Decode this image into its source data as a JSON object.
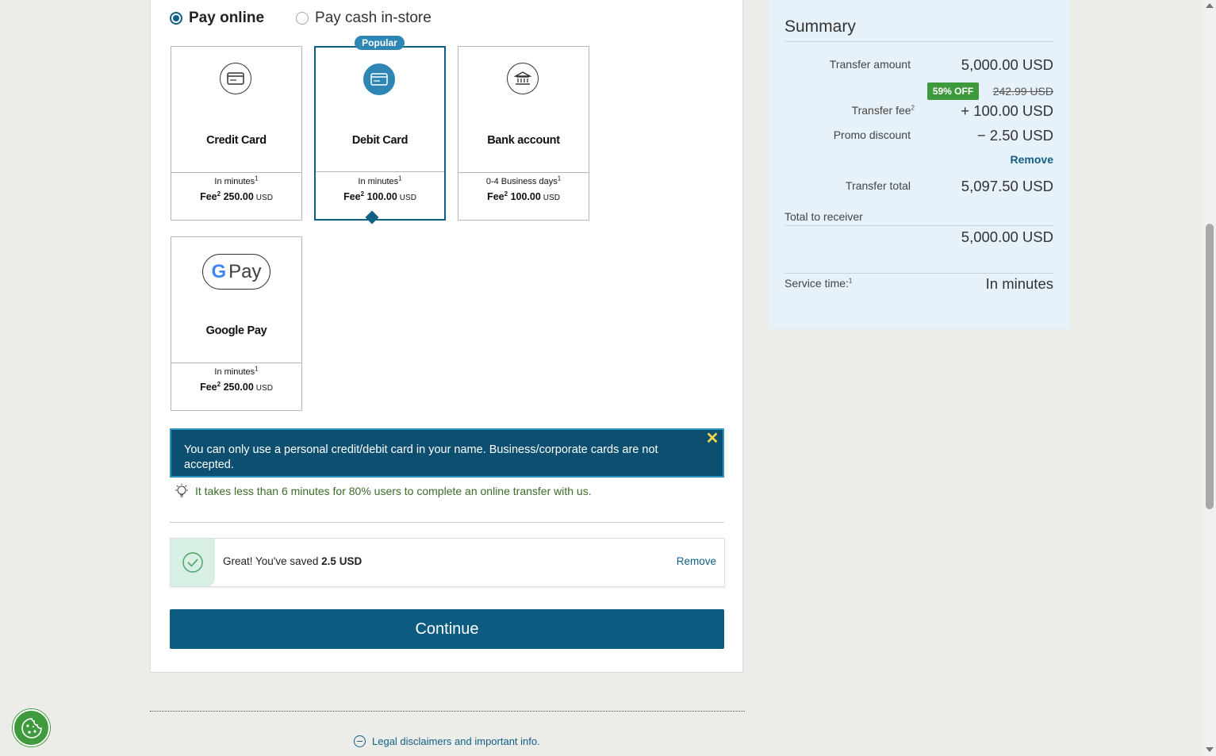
{
  "payment_mode": {
    "online_label": "Pay online",
    "cash_label": "Pay cash in-store",
    "selected": "online"
  },
  "popular_badge": "Popular",
  "methods": [
    {
      "name": "Credit Card",
      "time": "In minutes",
      "fee_label": "Fee",
      "fee_amount": "250.00",
      "currency": "USD",
      "icon": "credit-card-icon",
      "selected": false
    },
    {
      "name": "Debit Card",
      "time": "In minutes",
      "fee_label": "Fee",
      "fee_amount": "100.00",
      "currency": "USD",
      "icon": "debit-card-icon",
      "selected": true
    },
    {
      "name": "Bank account",
      "time": "0-4 Business days",
      "fee_label": "Fee",
      "fee_amount": "100.00",
      "currency": "USD",
      "icon": "bank-icon",
      "selected": false
    },
    {
      "name": "Google Pay",
      "time": "In minutes",
      "fee_label": "Fee",
      "fee_amount": "250.00",
      "currency": "USD",
      "icon": "google-pay-logo",
      "selected": false
    }
  ],
  "footnote_1": "1",
  "footnote_2": "2",
  "gpay_logo": {
    "g": "G",
    "pay": "Pay"
  },
  "notice": {
    "text": "You can only use a personal credit/debit card in your name. Business/corporate cards are not accepted.",
    "close": "✕"
  },
  "tip": "It takes less than 6 minutes for 80% users to complete an online transfer with us.",
  "promo": {
    "message_prefix": "Great! You've saved ",
    "saved_amount": "2.5 USD",
    "remove": "Remove"
  },
  "continue_label": "Continue",
  "legal_link": "Legal disclaimers and important info.",
  "summary": {
    "title": "Summary",
    "transfer_amount_label": "Transfer amount",
    "transfer_amount": "5,000.00 USD",
    "discount_badge": "59% OFF",
    "original_fee": "242.99 USD",
    "transfer_fee_label": "Transfer fee",
    "transfer_fee": "+ 100.00 USD",
    "promo_label": "Promo discount",
    "promo_value": "− 2.50 USD",
    "remove": "Remove",
    "total_label": "Transfer total",
    "total_value": "5,097.50 USD",
    "receiver_label": "Total  to receiver",
    "receiver_value": "5,000.00 USD",
    "service_time_label": "Service time:",
    "service_time_value": "In minutes"
  },
  "colors": {
    "brand": "#0c5b80",
    "accent": "#2e86b5",
    "success": "#3f9a3e",
    "notice_bg": "#0c4f70"
  }
}
